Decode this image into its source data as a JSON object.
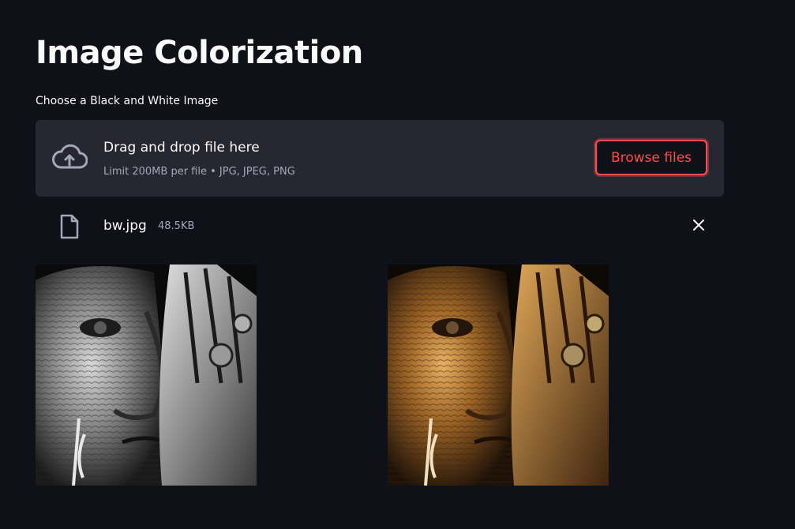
{
  "page": {
    "title": "Image Colorization"
  },
  "uploader": {
    "label": "Choose a Black and White Image",
    "drag_text": "Drag and drop file here",
    "limit_text": "Limit 200MB per file • JPG, JPEG, PNG",
    "browse_label": "Browse files",
    "icon": "cloud-upload-icon"
  },
  "file": {
    "name": "bw.jpg",
    "size": "48.5KB",
    "icon": "file-icon",
    "remove_icon": "close-icon"
  },
  "images": {
    "input_desc": "black and white portrait",
    "output_desc": "colorized portrait"
  },
  "colors": {
    "background": "#0e1117",
    "dropzone": "#262730",
    "accent": "#ff4b4b",
    "text": "#fafafa",
    "muted": "#a3a8b8"
  }
}
